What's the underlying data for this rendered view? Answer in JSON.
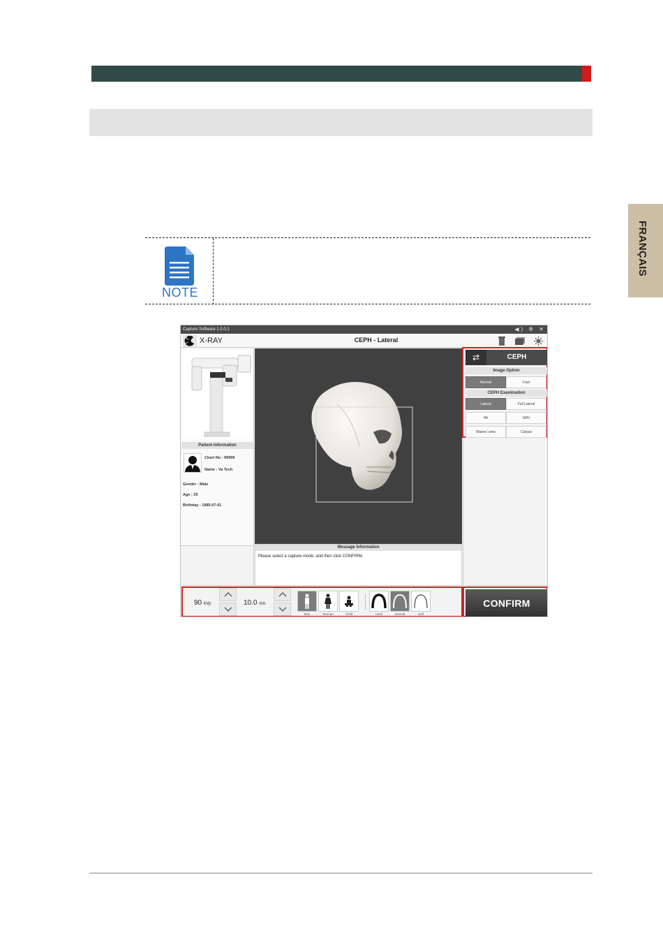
{
  "page": {
    "side_tab": "FRANÇAIS",
    "note_label": "NOTE"
  },
  "app": {
    "title": "Capture Software 1.0.0.1",
    "window_controls": "◀) ✲ ✕",
    "xray_label": "X-RAY",
    "mode_title": "CEPH - Lateral",
    "header_icons": [
      "trash-icon",
      "card-icon",
      "settings-light-icon"
    ]
  },
  "patient": {
    "header": "Patient Information",
    "chart_no": "Chart No : 99999",
    "name": "Name : Va Tech",
    "gender": "Gender : Male",
    "age": "Age : 29",
    "birthday": "Birthday : 1985-07-01"
  },
  "ceph": {
    "label": "CEPH",
    "image_option_label": "Image Option",
    "image_options": [
      "Normal",
      "Fast"
    ],
    "exam_label": "CEPH Examination",
    "exam_options": [
      "Lateral",
      "Full Lateral",
      "PA",
      "SMV",
      "Waters' view",
      "Carpus"
    ],
    "selected_image_option": "Normal",
    "selected_exam": "Lateral"
  },
  "message": {
    "header": "Message Information",
    "text": "Please select a capture mode, and then click CONFIRM."
  },
  "controls": {
    "kvp_value": "90",
    "kvp_unit": "kVp",
    "ma_value": "10.0",
    "ma_unit": "mA",
    "patient_types": [
      "Man",
      "Woman",
      "Child"
    ],
    "selected_patient_type": "Man",
    "arch_types": [
      "Hard",
      "Normal",
      "Soft"
    ],
    "selected_arch_type": "Normal",
    "confirm_label": "CONFIRM"
  },
  "colors": {
    "header_bar": "#324b49",
    "accent_red": "#d11a1a",
    "side_tab": "#cdbfa5",
    "note_blue": "#2d74c4",
    "highlight_frame": "#d41f1f"
  }
}
